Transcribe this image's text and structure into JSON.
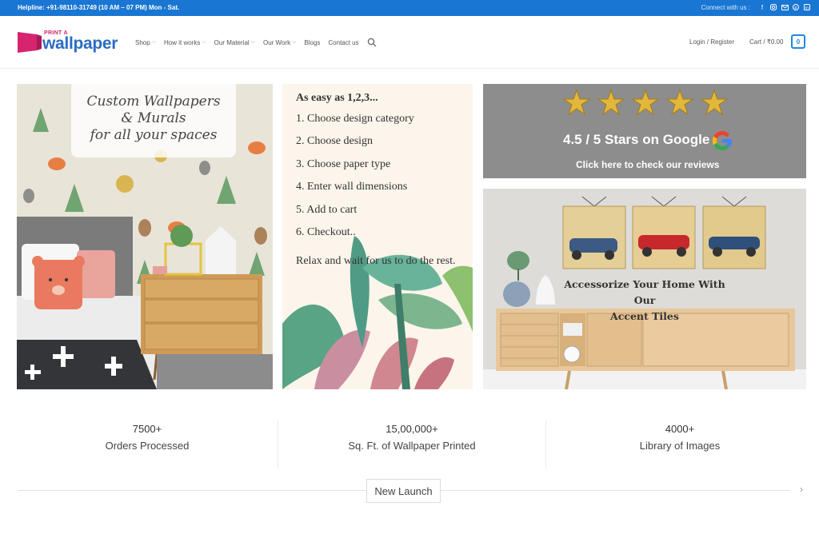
{
  "topbar": {
    "helpline": "Helpline: +91-98110-31749 (10 AM – 07 PM) Mon - Sat.",
    "connect_label": "Connect with us :",
    "social_icons": [
      "facebook-icon",
      "instagram-icon",
      "email-icon",
      "pinterest-icon",
      "linkedin-icon"
    ],
    "background_color": "#1976d2"
  },
  "header": {
    "logo_small": "PRINT A",
    "logo_big": "wallpaper",
    "nav": [
      {
        "label": "Shop",
        "has_dropdown": true
      },
      {
        "label": "How it works",
        "has_dropdown": true
      },
      {
        "label": "Our Material",
        "has_dropdown": true
      },
      {
        "label": "Our Work",
        "has_dropdown": true
      },
      {
        "label": "Blogs",
        "has_dropdown": false
      },
      {
        "label": "Contact us",
        "has_dropdown": false
      }
    ],
    "login": "Login / Register",
    "cart": "Cart / ₹0.00",
    "cart_count": "0"
  },
  "panels": {
    "custom": {
      "caption": [
        "Custom Wallpapers",
        "& Murals",
        "for all your spaces"
      ]
    },
    "steps": {
      "heading": "As easy as 1,2,3...",
      "items": [
        "1. Choose design category",
        "2. Choose design",
        "3. Choose paper type",
        "4. Enter wall dimensions",
        "5. Add to cart",
        "6. Checkout.."
      ],
      "footer": "Relax and wait for us to do the rest."
    },
    "reviews": {
      "rating": "4.5 / 5 Stars on Google",
      "link": "Click here to check our reviews",
      "star_count": 5
    },
    "tiles": {
      "headline": [
        "Accessorize Your Home With Our",
        "Accent Tiles"
      ]
    }
  },
  "stats": [
    {
      "number": "7500+",
      "label": "Orders Processed"
    },
    {
      "number": "15,00,000+",
      "label": "Sq. Ft. of Wallpaper Printed"
    },
    {
      "number": "4000+",
      "label": "Library of Images"
    }
  ],
  "launch": {
    "label": "New Launch"
  },
  "colors": {
    "accent": "#1e88e5",
    "logo_pink": "#d6246e",
    "logo_blue": "#2b6cc4"
  }
}
